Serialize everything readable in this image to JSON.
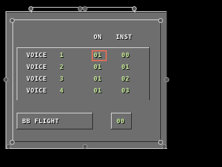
{
  "headers": {
    "on": "ON",
    "inst": "INST"
  },
  "voices": [
    {
      "label": "VOICE",
      "num": "1",
      "on": "01",
      "inst": "00"
    },
    {
      "label": "VOICE",
      "num": "2",
      "on": "01",
      "inst": "01"
    },
    {
      "label": "VOICE",
      "num": "3",
      "on": "01",
      "inst": "02"
    },
    {
      "label": "VOICE",
      "num": "4",
      "on": "01",
      "inst": "03"
    }
  ],
  "song": {
    "name": "BB FLIGHT",
    "value": "00"
  },
  "selected": {
    "row": 0,
    "column": "on"
  },
  "colors": {
    "panel": "#6e6e6e",
    "text": "#ffffff",
    "value": "#cff2a0",
    "cursor": "#d8705a"
  }
}
